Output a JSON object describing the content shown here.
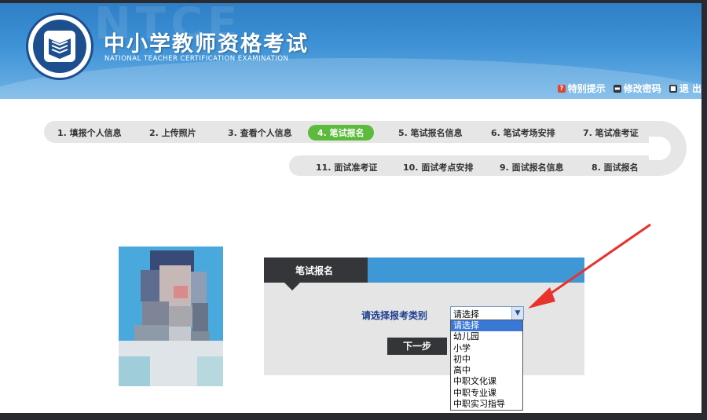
{
  "header": {
    "watermark": "NTCE",
    "title": "中小学教师资格考试",
    "subtitle": "NATIONAL TEACHER CERTIFICATION EXAMINATION",
    "links": [
      {
        "label": "特别提示",
        "icon": "tip-icon"
      },
      {
        "label": "修改密码",
        "icon": "password-icon"
      },
      {
        "label": "退 出",
        "icon": "exit-icon"
      }
    ]
  },
  "steps_row1": [
    {
      "label": "1. 填报个人信息"
    },
    {
      "label": "2. 上传照片"
    },
    {
      "label": "3. 查看个人信息"
    },
    {
      "label": "4. 笔试报名",
      "active": true
    },
    {
      "label": "5. 笔试报名信息"
    },
    {
      "label": "6. 笔试考场安排"
    },
    {
      "label": "7. 笔试准考证"
    }
  ],
  "steps_row2": [
    {
      "label": "11. 面试准考证"
    },
    {
      "label": "10. 面试考点安排"
    },
    {
      "label": "9. 面试报名信息"
    },
    {
      "label": "8. 面试报名"
    }
  ],
  "panel": {
    "tab_label": "笔试报名",
    "select_label": "请选择报考类别",
    "select_value": "请选择",
    "next_button": "下一步",
    "options": [
      "请选择",
      "幼儿园",
      "小学",
      "初中",
      "高中",
      "中职文化课",
      "中职专业课",
      "中职实习指导"
    ]
  },
  "colors": {
    "header_blue": "#3e92d6",
    "active_step": "#5cbb3a",
    "panel_dark": "#343639",
    "arrow_red": "#e8322c"
  }
}
